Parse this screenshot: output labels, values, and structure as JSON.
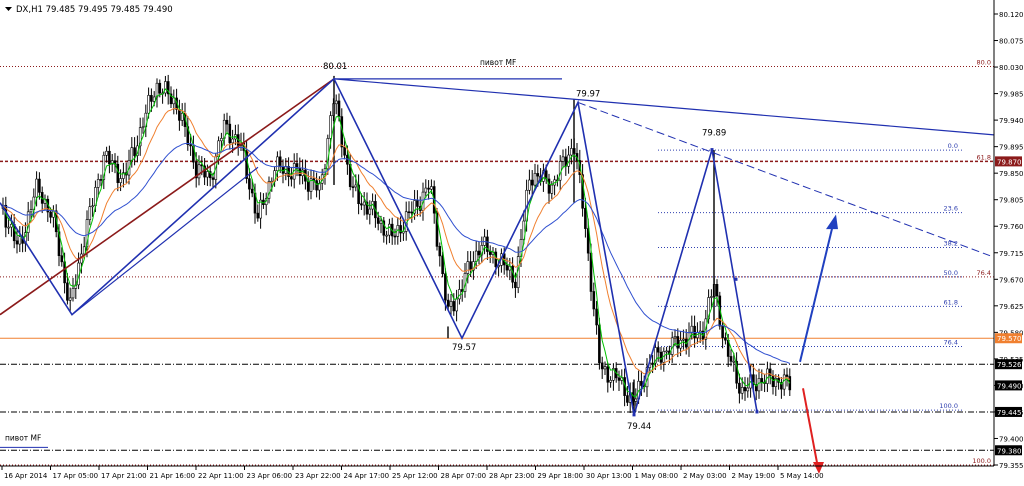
{
  "header": {
    "symbol_text": "DX,H1 79.485 79.495 79.485 79.490",
    "menu_icon": "triangle-down-icon"
  },
  "chart_data": {
    "type": "candlestick",
    "symbol": "DX",
    "timeframe": "H1",
    "ylim": [
      79.34,
      80.15
    ],
    "price_ticks": [
      "80.120",
      "80.075",
      "80.030",
      "79.985",
      "79.940",
      "79.895",
      "79.850",
      "79.805",
      "79.760",
      "79.715",
      "79.670",
      "79.625",
      "79.580",
      "79.535",
      "79.490",
      "79.445",
      "79.400",
      "79.355"
    ],
    "current_price": "79.490",
    "price_tags": [
      {
        "label": "79.870",
        "value": 79.87,
        "color": "#8b1a1a"
      },
      {
        "label": "79.570",
        "value": 79.57,
        "color": "#f08030"
      },
      {
        "label": "79.526",
        "value": 79.526,
        "color": "#000000"
      },
      {
        "label": "79.490",
        "value": 79.49,
        "color": "#000000"
      },
      {
        "label": "79.445",
        "value": 79.445,
        "color": "#000000"
      },
      {
        "label": "79.380",
        "value": 79.38,
        "color": "#000000"
      }
    ],
    "x_labels": [
      "16 Apr 2014",
      "17 Apr 05:00",
      "17 Apr 21:00",
      "21 Apr 16:00",
      "22 Apr 11:00",
      "23 Apr 06:00",
      "23 Apr 22:00",
      "24 Apr 17:00",
      "25 Apr 12:00",
      "28 Apr 07:00",
      "28 Apr 23:00",
      "29 Apr 18:00",
      "30 Apr 13:00",
      "1 May 08:00",
      "2 May 03:00",
      "2 May 19:00",
      "5 May 14:00"
    ],
    "horizontal_levels": [
      {
        "value": 80.031,
        "color": "#8b1a1a",
        "style": "dotted",
        "right_label": "80.0"
      },
      {
        "value": 79.87,
        "color": "#8b1a1a",
        "style": "dashed-thick",
        "right_label": "61.8"
      },
      {
        "value": 79.674,
        "color": "#8b1a1a",
        "style": "dotted",
        "right_label": "76.4"
      },
      {
        "value": 79.57,
        "color": "#f08030",
        "style": "solid",
        "right_label": ""
      },
      {
        "value": 79.526,
        "color": "#000000",
        "style": "dash-dot",
        "right_label": ""
      },
      {
        "value": 79.445,
        "color": "#000000",
        "style": "dash-dot",
        "right_label": ""
      },
      {
        "value": 79.38,
        "color": "#000000",
        "style": "dash-dot",
        "right_label": ""
      },
      {
        "value": 79.355,
        "color": "#8b1a1a",
        "style": "dotted",
        "right_label": "100.0"
      }
    ],
    "pivot_labels": [
      {
        "text": "пивот MF",
        "price": 80.03
      },
      {
        "text": "пивот MF",
        "price": 79.39
      }
    ],
    "wave_labels": [
      {
        "text": "80.01",
        "price": 80.01
      },
      {
        "text": "79.97",
        "price": 79.97
      },
      {
        "text": "79.89",
        "price": 79.89
      },
      {
        "text": "79.57",
        "price": 79.57
      },
      {
        "text": "79.44",
        "price": 79.44
      }
    ],
    "fibonacci_levels": [
      {
        "label": "0.0",
        "value": 79.889
      },
      {
        "label": "23.6",
        "value": 79.783
      },
      {
        "label": "38.2",
        "value": 79.724
      },
      {
        "label": "50.0",
        "value": 79.674
      },
      {
        "label": "61.8",
        "value": 79.624
      },
      {
        "label": "76.4",
        "value": 79.556
      },
      {
        "label": "100.0",
        "value": 79.448
      }
    ],
    "series": [
      {
        "name": "",
        "color": "#00c000"
      },
      {
        "name": "",
        "color": "#f08030"
      },
      {
        "name": "",
        "color": "#3050d0"
      }
    ],
    "grid": false
  }
}
